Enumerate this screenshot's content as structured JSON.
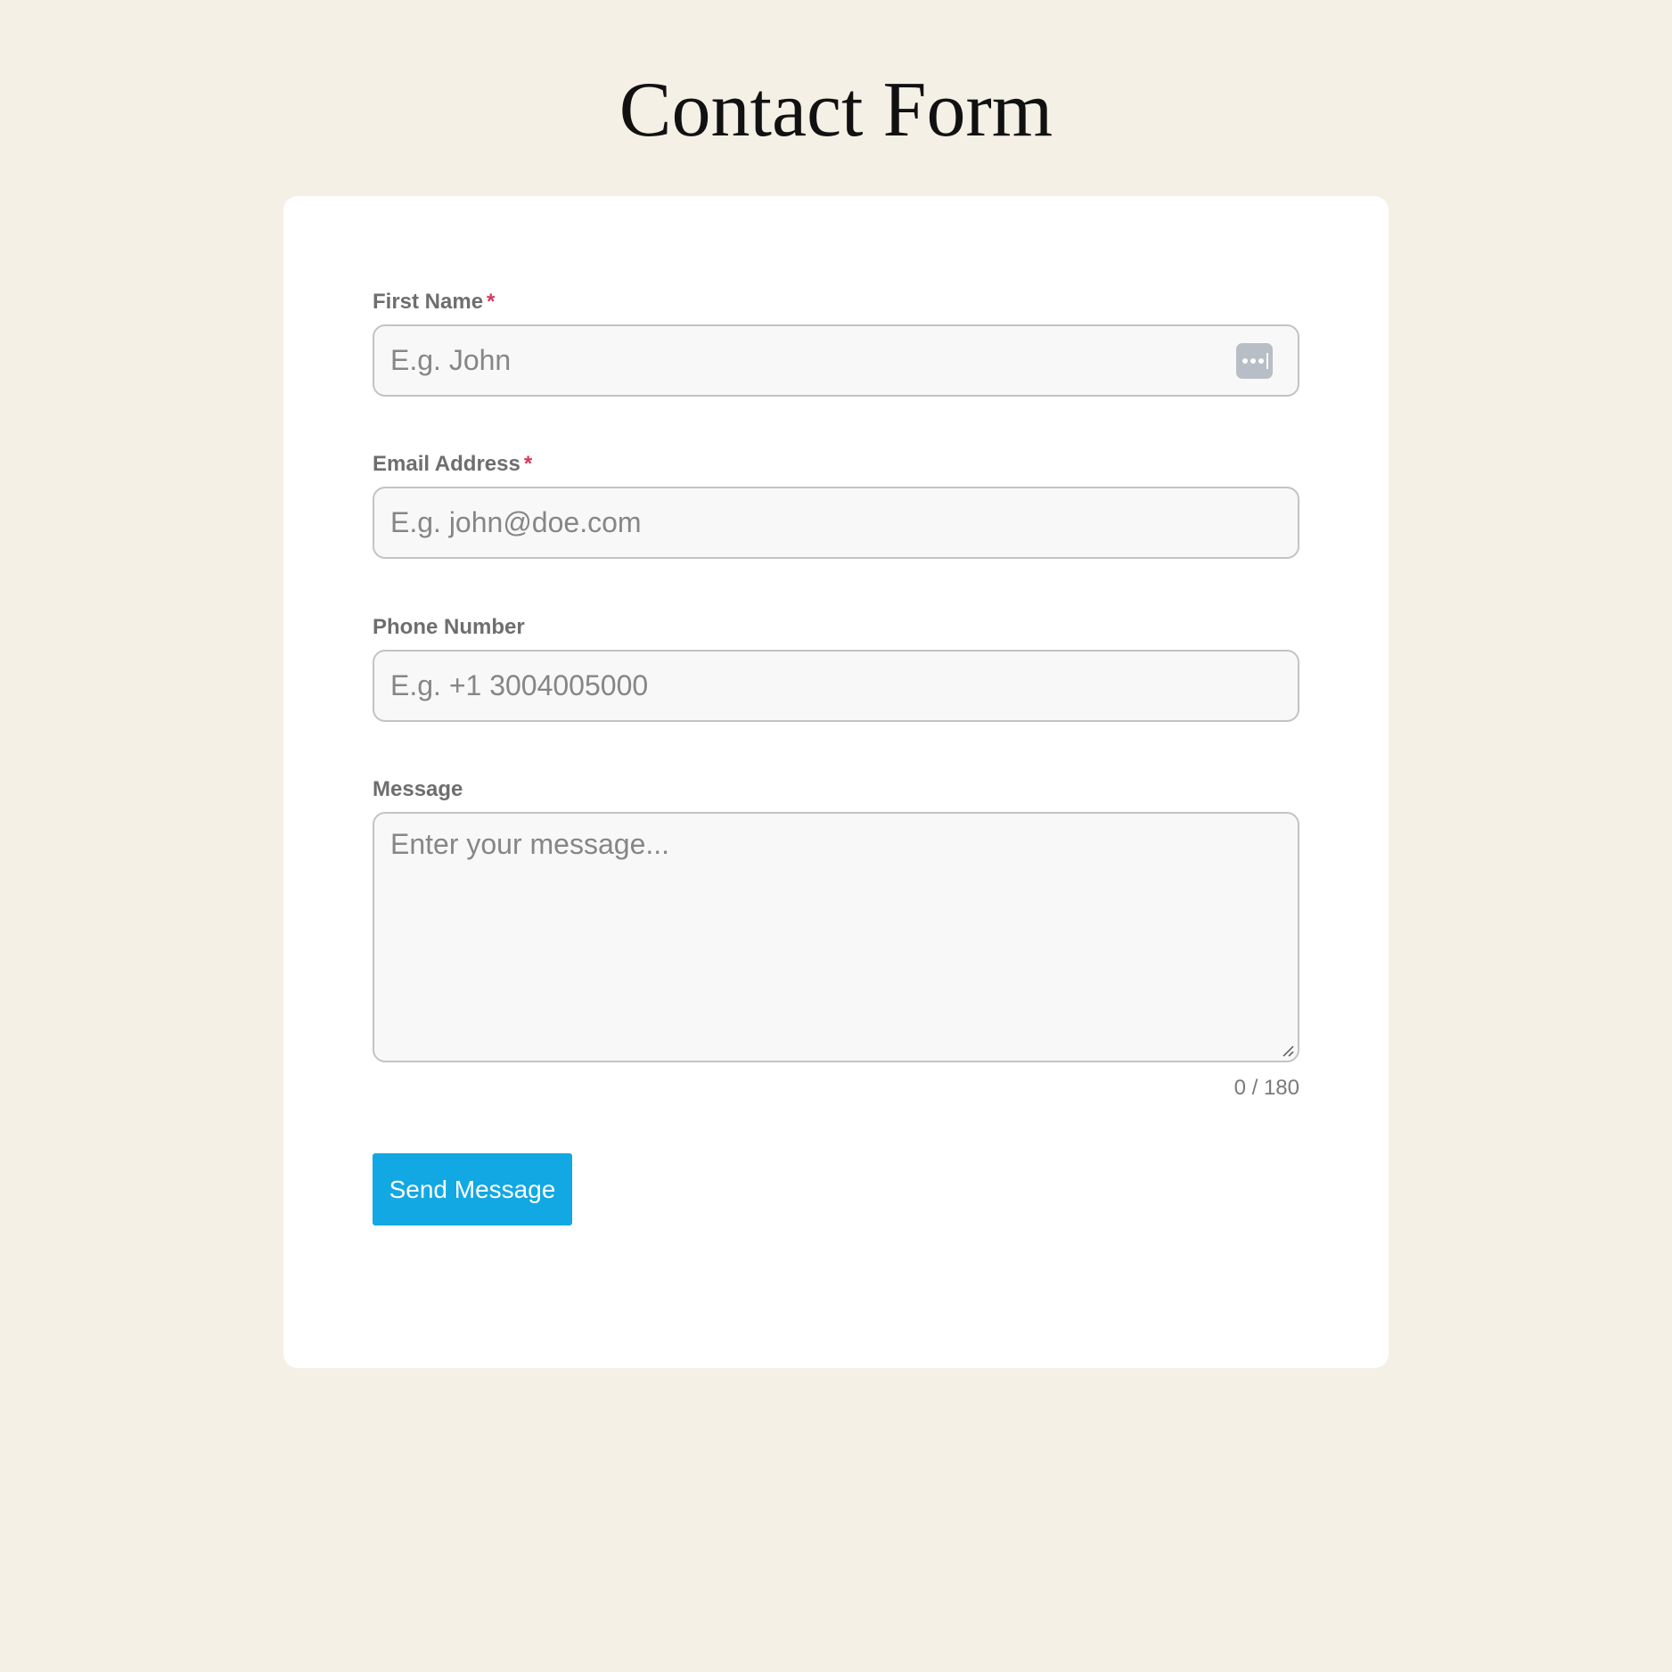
{
  "page": {
    "title": "Contact Form"
  },
  "form": {
    "first_name": {
      "label": "First Name",
      "required_mark": "*",
      "placeholder": "E.g. John",
      "value": ""
    },
    "email": {
      "label": "Email Address",
      "required_mark": "*",
      "placeholder": "E.g. john@doe.com",
      "value": ""
    },
    "phone": {
      "label": "Phone Number",
      "placeholder": "E.g. +1 3004005000",
      "value": ""
    },
    "message": {
      "label": "Message",
      "placeholder": "Enter your message...",
      "value": "",
      "counter": "0 / 180"
    },
    "submit_label": "Send Message"
  },
  "icons": {
    "autofill": "password-manager-autofill-icon",
    "resize": "resize-grip-icon"
  },
  "colors": {
    "page_background": "#f4f0e6",
    "card_background": "#ffffff",
    "required": "#d6365c",
    "button": "#12a8e3",
    "input_background": "#f8f8f8",
    "input_border": "#c3c3c3"
  }
}
